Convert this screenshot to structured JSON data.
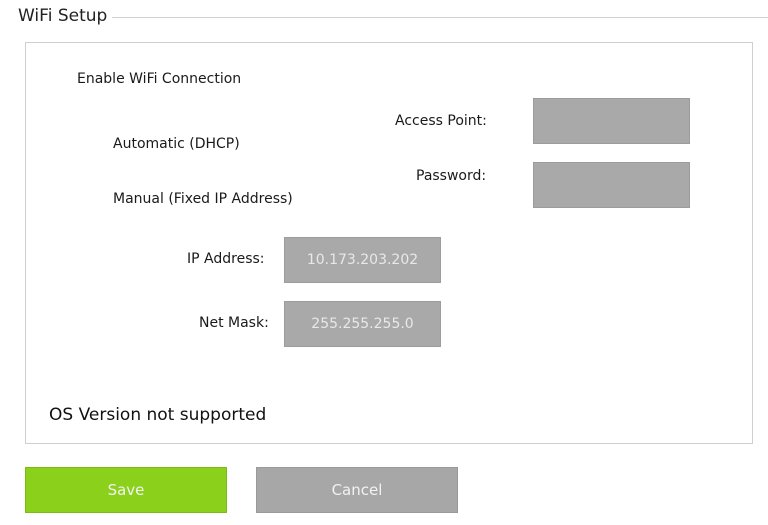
{
  "group": {
    "title": "WiFi Setup"
  },
  "wifi": {
    "enable_label": "Enable WiFi Connection",
    "automatic_label": "Automatic (DHCP)",
    "manual_label": "Manual (Fixed IP Address)",
    "access_point_label": "Access Point:",
    "access_point_value": "",
    "password_label": "Password:",
    "password_value": "",
    "ip_address_label": "IP Address:",
    "ip_address_value": "10.173.203.202",
    "net_mask_label": "Net Mask:",
    "net_mask_value": "255.255.255.0"
  },
  "status": {
    "os_note": "OS Version not supported"
  },
  "actions": {
    "save_label": "Save",
    "cancel_label": "Cancel"
  },
  "colors": {
    "save_button": "#8bd11b",
    "disabled_button": "#a7a7a7",
    "disabled_field": "#a9a9a9"
  }
}
